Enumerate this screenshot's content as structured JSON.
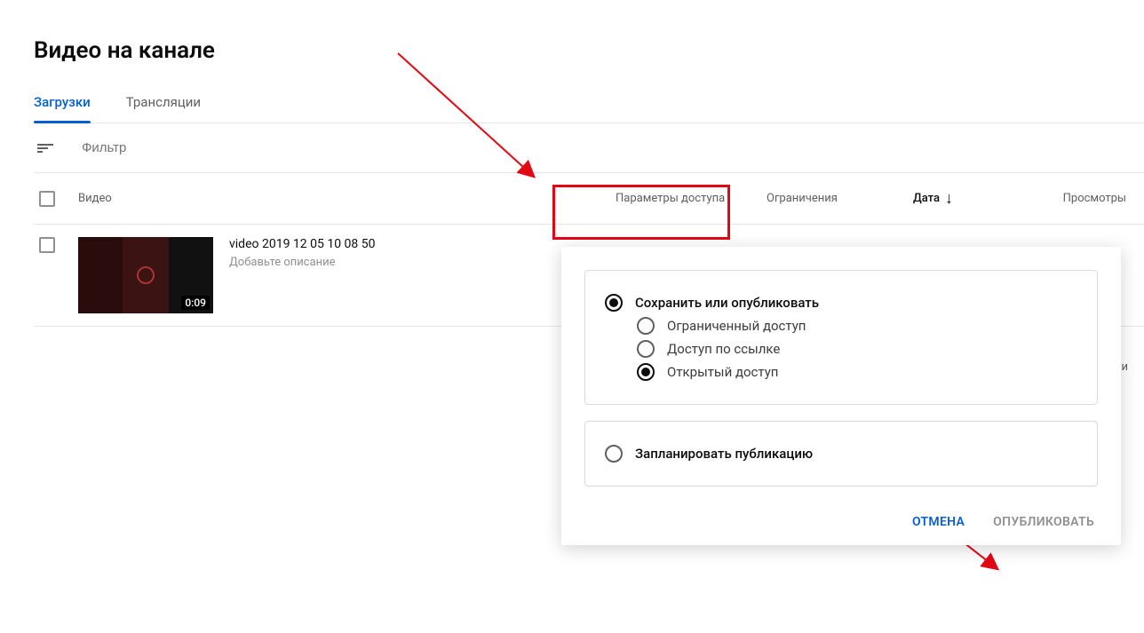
{
  "page_title": "Видео на канале",
  "tabs": [
    {
      "label": "Загрузки",
      "active": true
    },
    {
      "label": "Трансляции",
      "active": false
    }
  ],
  "filter": {
    "placeholder": "Фильтр"
  },
  "columns": {
    "video": "Видео",
    "access": "Параметры доступа",
    "restrict": "Ограничения",
    "date": "Дата",
    "views": "Просмотры"
  },
  "video": {
    "title": "video 2019 12 05 10 08 50",
    "desc_placeholder": "Добавьте описание",
    "duration": "0:09"
  },
  "truncated_char": "и",
  "popup": {
    "section1_title": "Сохранить или опубликовать",
    "option_private": "Ограниченный доступ",
    "option_unlisted": "Доступ по ссылке",
    "option_public": "Открытый доступ",
    "section2_title": "Запланировать публикацию",
    "cancel": "ОТМЕНА",
    "publish": "ОПУБЛИКОВАТЬ"
  }
}
